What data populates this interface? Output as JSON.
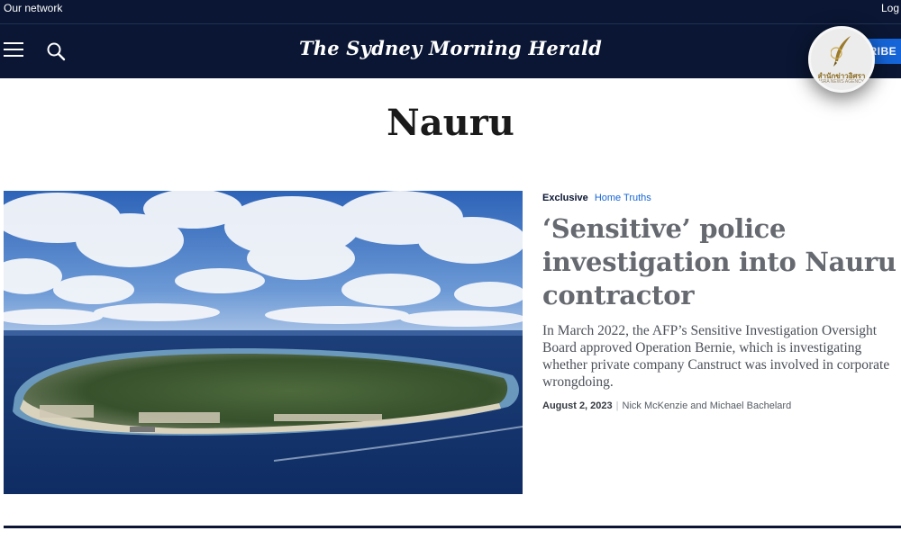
{
  "topbar": {
    "network_label": "Our network",
    "login_label": "Log i"
  },
  "header": {
    "masthead": "The Sydney Morning Herald",
    "subscribe_label": "SUBSCRIBE",
    "badge_text": "สำนักข่าวอิศรา",
    "badge_sub": "ISRA NEWS AGENCY"
  },
  "page": {
    "title": "Nauru"
  },
  "article": {
    "tag": "Exclusive",
    "series": "Home Truths",
    "headline": "‘Sensitive’ police investigation into Nauru contractor",
    "summary": "In March 2022, the AFP’s Sensitive Investigation Oversight Board approved Operation Bernie, which is investigating whether private company Canstruct was involved in corporate wrongdoing.",
    "date": "August 2, 2023",
    "authors": "Nick McKenzie and Michael Bachelard"
  },
  "colors": {
    "navy": "#0a1633",
    "accent_blue": "#1565d8"
  },
  "icons": {
    "menu": "hamburger-icon",
    "search": "search-icon"
  }
}
